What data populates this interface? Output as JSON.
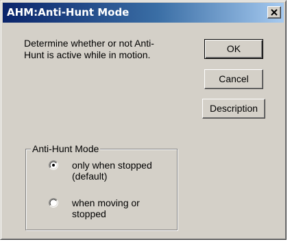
{
  "window": {
    "title": "AHM:Anti-Hunt Mode"
  },
  "description": "Determine whether or not Anti-\nHunt is active while in motion.",
  "buttons": {
    "ok": "OK",
    "cancel": "Cancel",
    "description": "Description"
  },
  "group": {
    "label": "Anti-Hunt Mode",
    "options": [
      {
        "label": "only when stopped\n(default)",
        "selected": true
      },
      {
        "label": "when moving or\nstopped",
        "selected": false
      }
    ]
  },
  "icons": {
    "close": "close-icon",
    "radio_selected": "radio-selected-icon",
    "radio_unselected": "radio-unselected-icon"
  },
  "colors": {
    "titlebar_start": "#0a246a",
    "titlebar_end": "#a6caf0",
    "face": "#d4d0c8"
  }
}
